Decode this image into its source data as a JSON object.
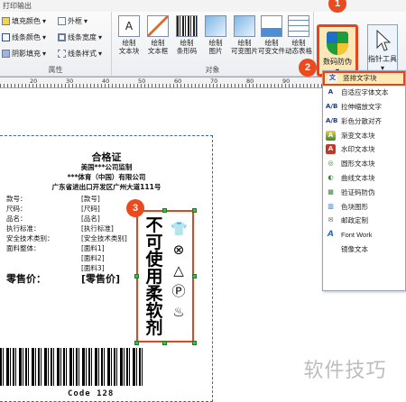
{
  "window": {
    "title": "打印输出"
  },
  "ribbon": {
    "attr_group": {
      "label": "属性",
      "fill_color": "填充颜色",
      "line_color": "线条颜色",
      "shade_fill": "阴影填充",
      "outline": "外框",
      "line_width": "线条宽度",
      "line_style": "线条样式"
    },
    "object_group": {
      "label": "对象",
      "buttons": [
        {
          "label": "绘制\n文本块"
        },
        {
          "label": "绘制\n文本框"
        },
        {
          "label": "绘制\n条形码"
        },
        {
          "label": "绘制\n图片"
        },
        {
          "label": "绘制\n可变图片"
        },
        {
          "label": "绘制\n可变文件"
        },
        {
          "label": "绘制\n动态表格"
        }
      ]
    },
    "anti_counterfeit": {
      "label": "数码防伪"
    },
    "draw_tool": {
      "label": "指针工具"
    }
  },
  "ruler": {
    "ticks": [
      "20",
      "30",
      "40",
      "50",
      "60",
      "70",
      "80",
      "90"
    ]
  },
  "steps": [
    "1",
    "2",
    "3"
  ],
  "dropdown": {
    "items": [
      {
        "label": "竖排文字块",
        "icon": "vertical-text-icon",
        "glyph": "文",
        "color": "#1a3f8f"
      },
      {
        "label": "自适应字体文本",
        "icon": "autofit-text-icon",
        "glyph": "A",
        "color": "#1a3f8f"
      },
      {
        "label": "拉伸缩放文字",
        "icon": "stretch-text-icon",
        "glyph": "A/B",
        "color": "#1a3f8f"
      },
      {
        "label": "彩色分散对齐",
        "icon": "color-align-icon",
        "glyph": "A/B",
        "color": "#1a3f8f"
      },
      {
        "label": "渐变文本块",
        "icon": "gradient-text-icon",
        "glyph": "A",
        "color": "#2f8a2f"
      },
      {
        "label": "水印文本块",
        "icon": "watermark-text-icon",
        "glyph": "A",
        "color": "#c0392b"
      },
      {
        "label": "圆形文本块",
        "icon": "circle-text-icon",
        "glyph": "◎",
        "color": "#2f7a2f"
      },
      {
        "label": "曲线文本块",
        "icon": "curve-text-icon",
        "glyph": "◐",
        "color": "#2f7a2f"
      },
      {
        "label": "验证码防伪",
        "icon": "verify-code-icon",
        "glyph": "▦",
        "color": "#2f7a2f"
      },
      {
        "label": "色块图形",
        "icon": "color-block-icon",
        "glyph": "▥",
        "color": "#1b6fc4"
      },
      {
        "label": "邮政定制",
        "icon": "postal-icon",
        "glyph": "✉",
        "color": "#555555"
      },
      {
        "label": "Font Work",
        "icon": "font-work-icon",
        "glyph": "A",
        "color": "#1b6fc4"
      },
      {
        "label": "镜像文本",
        "icon": "mirror-text-icon",
        "glyph": "",
        "color": "#888888"
      }
    ]
  },
  "label": {
    "title": "合格证",
    "supervisor": "美国***公司监制",
    "company": "***体育（中国）有限公司",
    "address": "广东省进出口开发区广州大道111号",
    "fields": [
      {
        "name": "款号：",
        "value": "[款号]"
      },
      {
        "name": "尺码：",
        "value": "[尺码]"
      },
      {
        "name": "品名：",
        "value": "[品名]"
      },
      {
        "name": "执行标准：",
        "value": "[执行标准]"
      },
      {
        "name": "安全技术类别：",
        "value": "[安全技术类别]"
      },
      {
        "name": "面料整体：",
        "value": "[面料1]"
      }
    ],
    "extra_fabrics": [
      "[面料2]",
      "[面料3]"
    ],
    "price_label": "零售价：",
    "price_value": "[零售价]",
    "vertical_text": "不可使用柔软剂",
    "barcode_text": "Code 128"
  },
  "watermark": "软件技巧"
}
